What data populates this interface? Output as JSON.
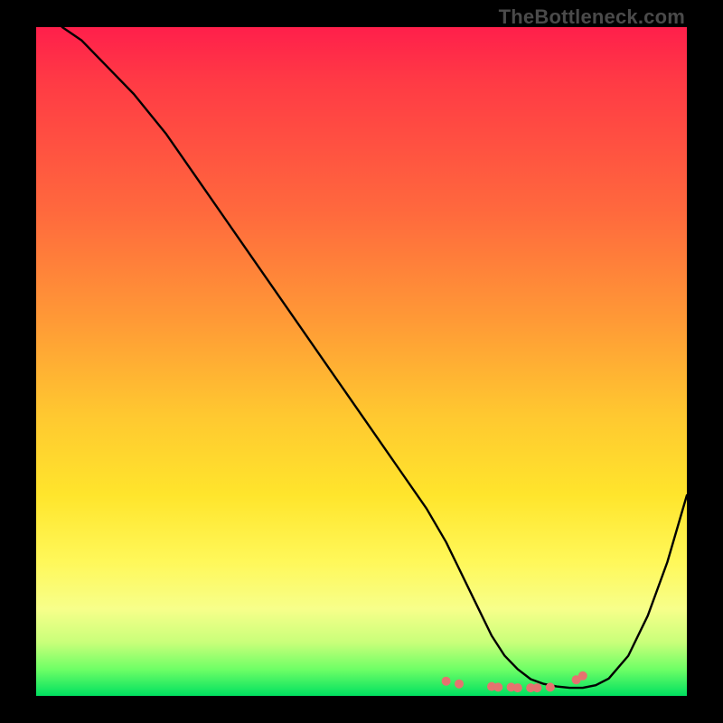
{
  "watermark": "TheBottleneck.com",
  "chart_data": {
    "type": "line",
    "title": "",
    "xlabel": "",
    "ylabel": "",
    "xlim": [
      0,
      100
    ],
    "ylim": [
      0,
      100
    ],
    "grid": false,
    "legend": false,
    "series": [
      {
        "name": "bottleneck-curve",
        "color": "#000000",
        "x": [
          4,
          7,
          10,
          15,
          20,
          25,
          30,
          35,
          40,
          45,
          50,
          55,
          60,
          63,
          65,
          68,
          70,
          72,
          74,
          76,
          78,
          80,
          82,
          84,
          86,
          88,
          91,
          94,
          97,
          100
        ],
        "y": [
          100,
          98,
          95,
          90,
          84,
          77,
          70,
          63,
          56,
          49,
          42,
          35,
          28,
          23,
          19,
          13,
          9,
          6,
          4,
          2.5,
          1.8,
          1.4,
          1.2,
          1.2,
          1.6,
          2.6,
          6,
          12,
          20,
          30
        ]
      }
    ],
    "markers": {
      "name": "bottom-markers",
      "color": "#e5736f",
      "points": [
        {
          "x": 63,
          "y": 2.2
        },
        {
          "x": 65,
          "y": 1.8
        },
        {
          "x": 70,
          "y": 1.4
        },
        {
          "x": 71,
          "y": 1.3
        },
        {
          "x": 73,
          "y": 1.3
        },
        {
          "x": 74,
          "y": 1.2
        },
        {
          "x": 76,
          "y": 1.2
        },
        {
          "x": 77,
          "y": 1.2
        },
        {
          "x": 79,
          "y": 1.3
        },
        {
          "x": 83,
          "y": 2.4
        },
        {
          "x": 84,
          "y": 3.0
        }
      ]
    }
  }
}
